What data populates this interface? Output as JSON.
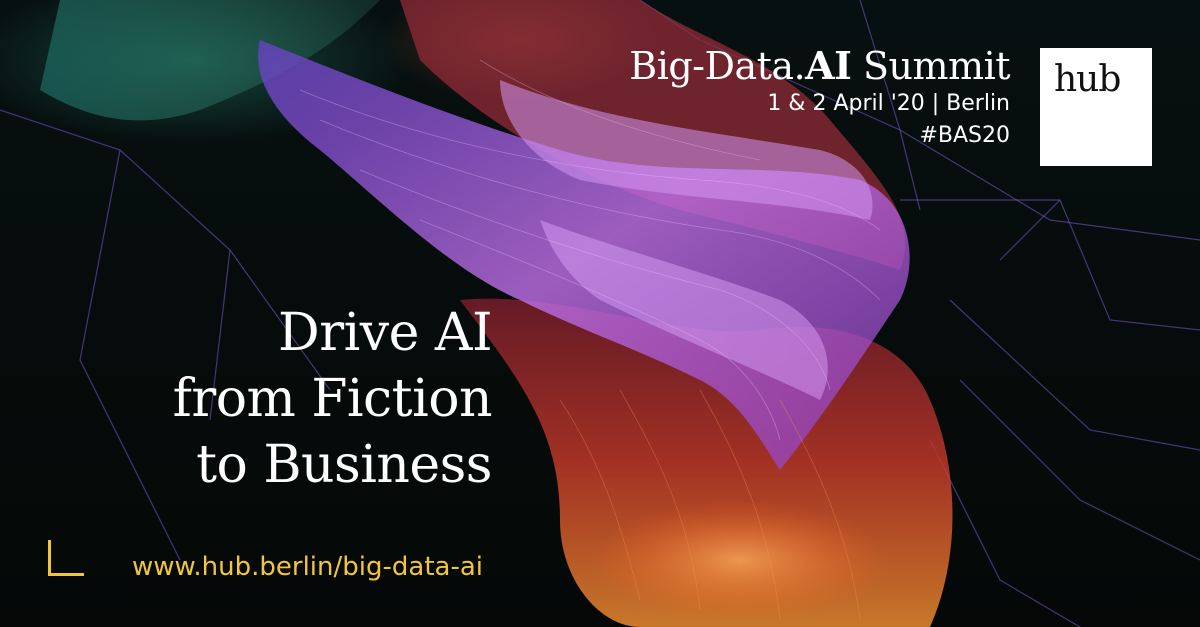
{
  "event": {
    "title_part1": "Big-Data.",
    "title_ai": "AI",
    "title_part2": " Summit",
    "date_location": "1 & 2 April '20 | Berlin",
    "hashtag": "#BAS20"
  },
  "logo": {
    "text": "hub"
  },
  "headline": {
    "line1": "Drive AI",
    "line2": "from Fiction",
    "line3": "to Business"
  },
  "url": "www.hub.berlin/big-data-ai",
  "colors": {
    "background": "#050807",
    "accent_yellow": "#f2c53d",
    "text_white": "#ffffff",
    "art_violet": "#b070e0",
    "art_red": "#c0302a",
    "art_orange": "#e07030",
    "art_teal": "#2a8a78"
  }
}
